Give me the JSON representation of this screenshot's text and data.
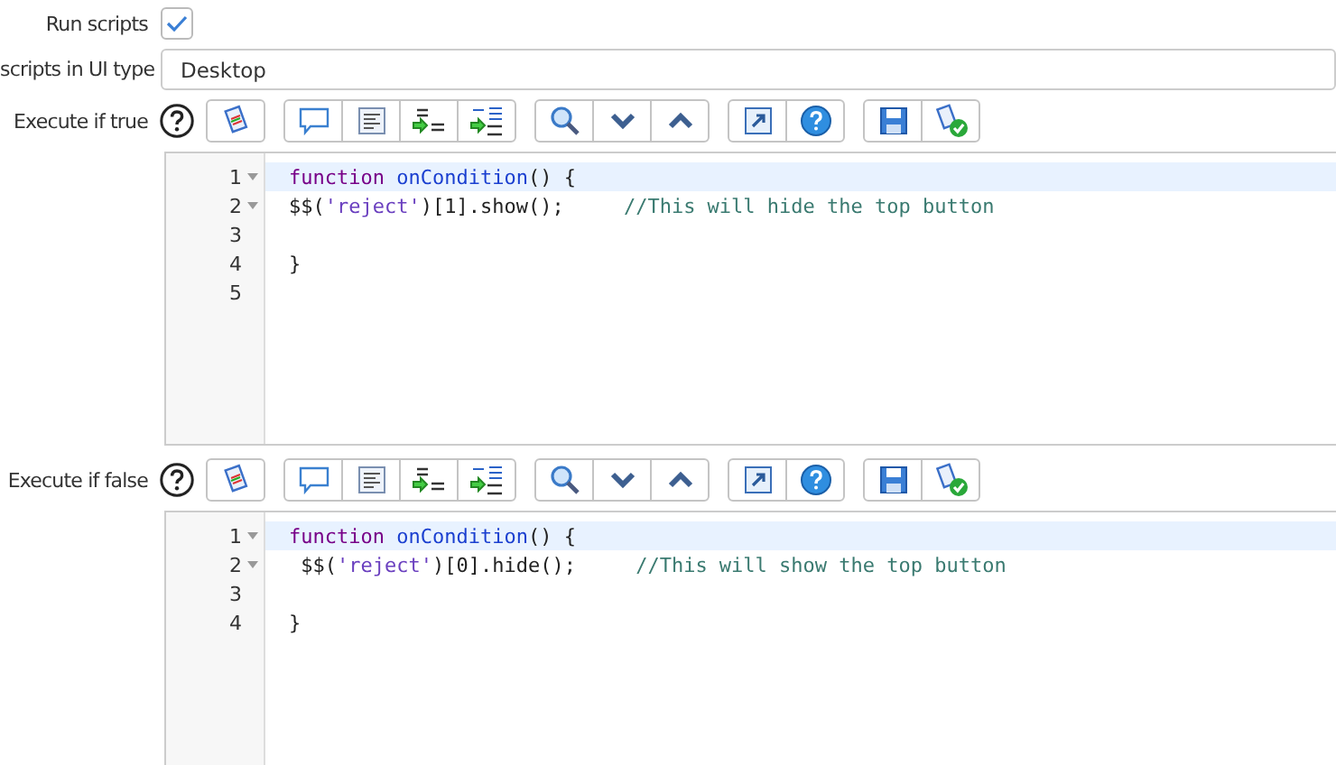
{
  "run_scripts": {
    "label": "Run scripts",
    "checked": true
  },
  "ui_type": {
    "label": "scripts in UI type",
    "value": "Desktop"
  },
  "sections": [
    {
      "label": "Execute if true",
      "lines": [
        {
          "number": "1",
          "foldable": true,
          "active": true,
          "tokens": [
            {
              "kind": "keyword",
              "text": "function"
            },
            {
              "kind": "def",
              "text": " onCondition"
            },
            {
              "kind": "plain",
              "text": "() {"
            }
          ]
        },
        {
          "number": "2",
          "foldable": true,
          "active": false,
          "tokens": [
            {
              "kind": "plain",
              "text": "$$("
            },
            {
              "kind": "string",
              "text": "'reject'"
            },
            {
              "kind": "plain",
              "text": ")[1].show();     "
            },
            {
              "kind": "comment",
              "text": "//This will hide the top button"
            }
          ]
        },
        {
          "number": "3",
          "foldable": false,
          "active": false
        },
        {
          "number": "4",
          "foldable": false,
          "active": false,
          "tokens": [
            {
              "kind": "plain",
              "text": "}"
            }
          ]
        },
        {
          "number": "5",
          "foldable": false,
          "active": false
        }
      ]
    },
    {
      "label": "Execute if false",
      "lines": [
        {
          "number": "1",
          "foldable": true,
          "active": true,
          "tokens": [
            {
              "kind": "keyword",
              "text": "function"
            },
            {
              "kind": "def",
              "text": " onCondition"
            },
            {
              "kind": "plain",
              "text": "() {"
            }
          ]
        },
        {
          "number": "2",
          "foldable": true,
          "active": false,
          "tokens": [
            {
              "kind": "plain",
              "text": " $$("
            },
            {
              "kind": "string",
              "text": "'reject'"
            },
            {
              "kind": "plain",
              "text": ")[0].hide();     "
            },
            {
              "kind": "comment",
              "text": "//This will show the top button"
            }
          ]
        },
        {
          "number": "3",
          "foldable": false,
          "active": false
        },
        {
          "number": "4",
          "foldable": false,
          "active": false,
          "tokens": [
            {
              "kind": "plain",
              "text": "}"
            }
          ]
        }
      ]
    }
  ]
}
